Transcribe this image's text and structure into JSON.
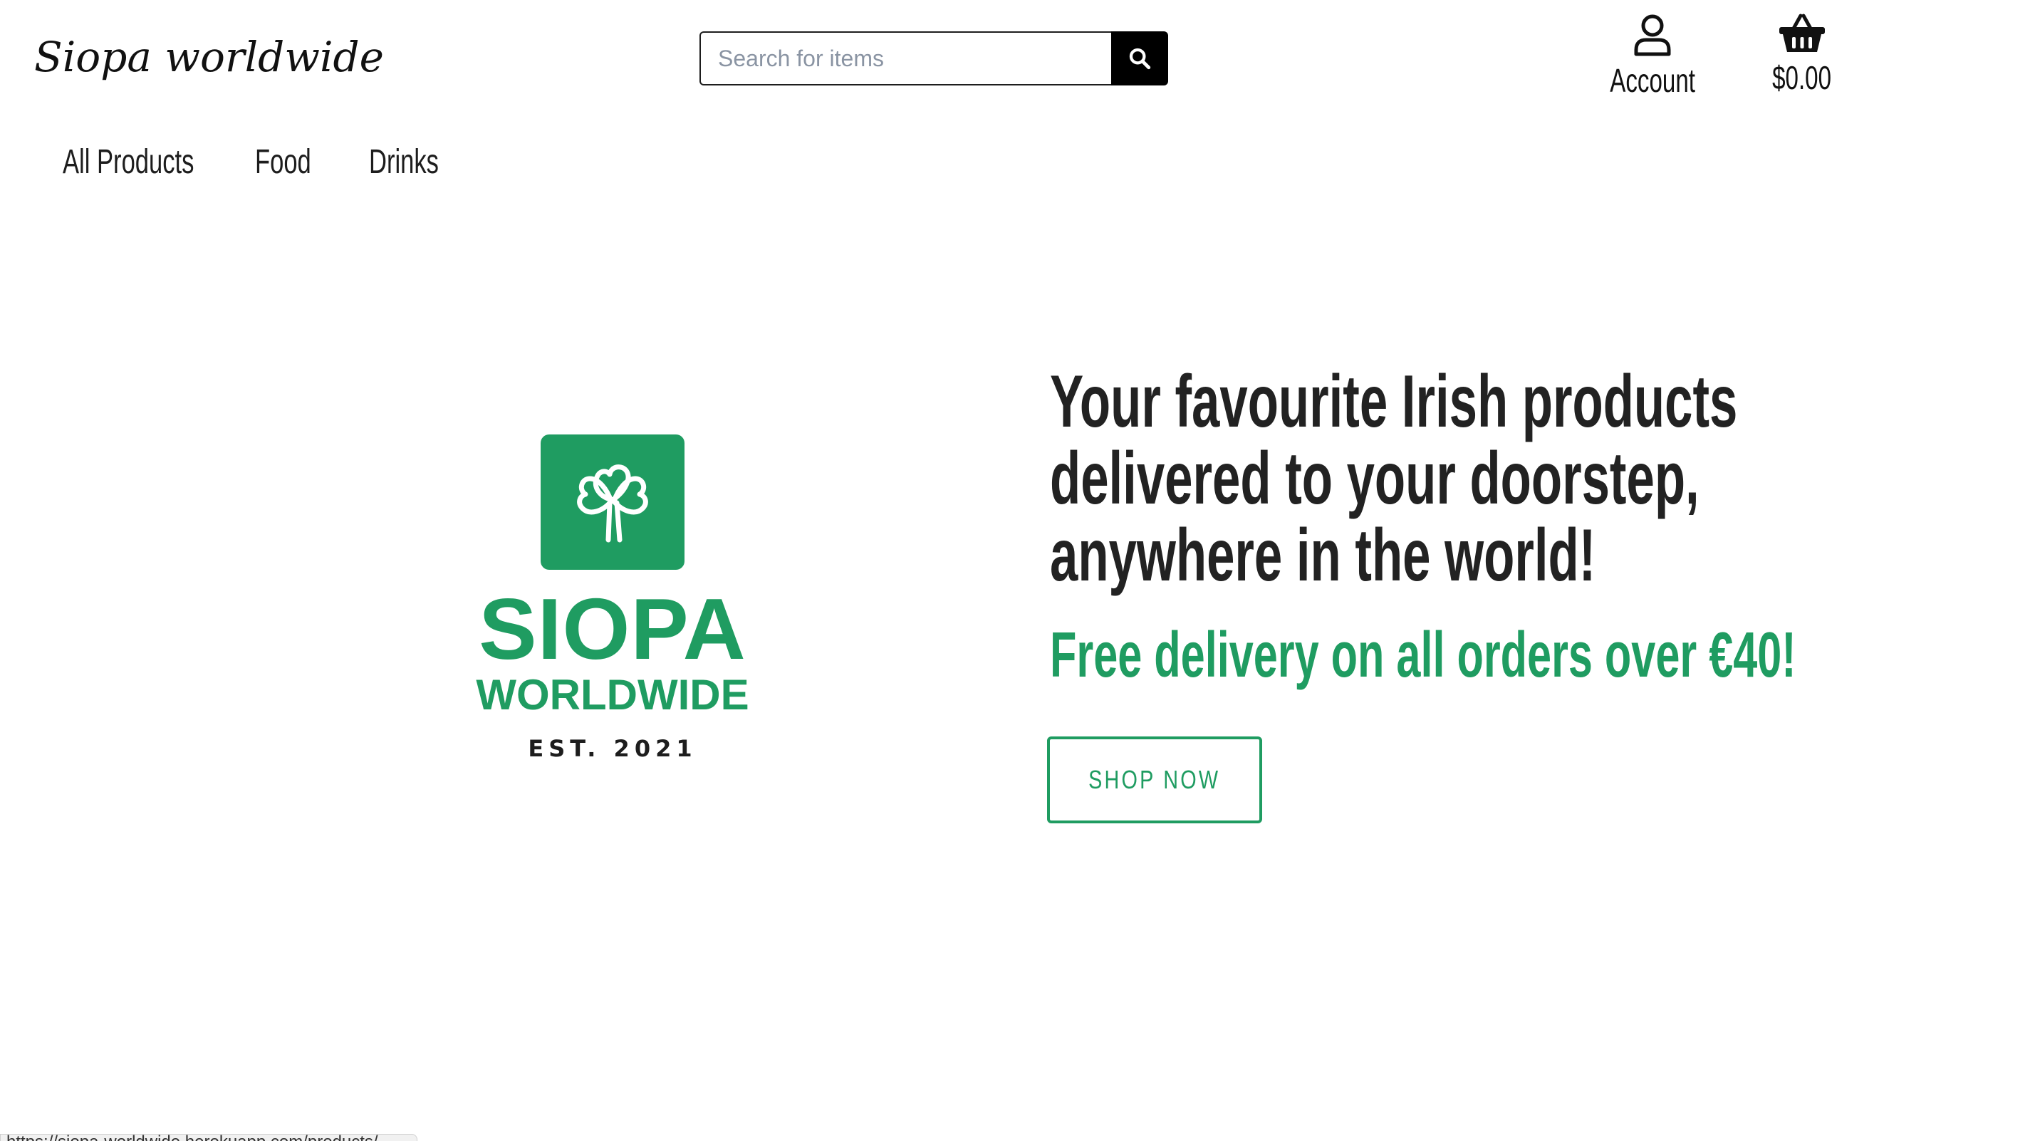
{
  "header": {
    "brand": "Siopa worldwide",
    "search": {
      "placeholder": "Search for items",
      "value": ""
    },
    "account_label": "Account",
    "cart_total": "$0.00"
  },
  "nav": {
    "items": [
      {
        "label": "All Products"
      },
      {
        "label": "Food"
      },
      {
        "label": "Drinks"
      }
    ]
  },
  "hero": {
    "logo": {
      "title": "SIOPA",
      "subtitle": "WORLDWIDE",
      "established": "EST. 2021"
    },
    "heading_lines": [
      "Your favourite Irish products",
      "delivered to your doorstep,",
      "anywhere in the world!"
    ],
    "subheading": "Free delivery on all orders over €40!",
    "cta_label": "SHOP NOW"
  },
  "status_bar": {
    "url": "https://siopa-worldwide.herokuapp.com/products/"
  },
  "colors": {
    "brand_green": "#1f9c61",
    "text_dark": "#222222",
    "black": "#000000"
  },
  "icons": [
    "search-icon",
    "user-icon",
    "basket-icon",
    "shamrock-icon"
  ]
}
